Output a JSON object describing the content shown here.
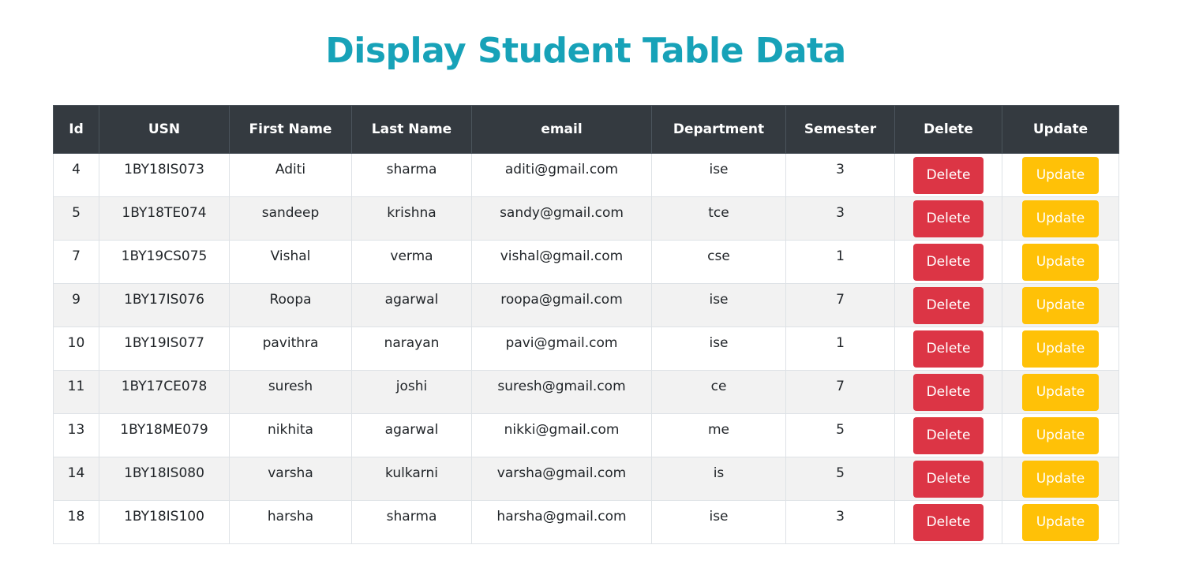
{
  "page": {
    "title": "Display Student Table Data"
  },
  "table": {
    "headers": [
      "Id",
      "USN",
      "First Name",
      "Last Name",
      "email",
      "Department",
      "Semester",
      "Delete",
      "Update"
    ],
    "rows": [
      {
        "id": "4",
        "usn": "1BY18IS073",
        "first_name": "Aditi",
        "last_name": "sharma",
        "email": "aditi@gmail.com",
        "department": "ise",
        "semester": "3",
        "delete_label": "Delete",
        "update_label": "Update"
      },
      {
        "id": "5",
        "usn": "1BY18TE074",
        "first_name": "sandeep",
        "last_name": "krishna",
        "email": "sandy@gmail.com",
        "department": "tce",
        "semester": "3",
        "delete_label": "Delete",
        "update_label": "Update"
      },
      {
        "id": "7",
        "usn": "1BY19CS075",
        "first_name": "Vishal",
        "last_name": "verma",
        "email": "vishal@gmail.com",
        "department": "cse",
        "semester": "1",
        "delete_label": "Delete",
        "update_label": "Update"
      },
      {
        "id": "9",
        "usn": "1BY17IS076",
        "first_name": "Roopa",
        "last_name": "agarwal",
        "email": "roopa@gmail.com",
        "department": "ise",
        "semester": "7",
        "delete_label": "Delete",
        "update_label": "Update"
      },
      {
        "id": "10",
        "usn": "1BY19IS077",
        "first_name": "pavithra",
        "last_name": "narayan",
        "email": "pavi@gmail.com",
        "department": "ise",
        "semester": "1",
        "delete_label": "Delete",
        "update_label": "Update"
      },
      {
        "id": "11",
        "usn": "1BY17CE078",
        "first_name": "suresh",
        "last_name": "joshi",
        "email": "suresh@gmail.com",
        "department": "ce",
        "semester": "7",
        "delete_label": "Delete",
        "update_label": "Update"
      },
      {
        "id": "13",
        "usn": "1BY18ME079",
        "first_name": "nikhita",
        "last_name": "agarwal",
        "email": "nikki@gmail.com",
        "department": "me",
        "semester": "5",
        "delete_label": "Delete",
        "update_label": "Update"
      },
      {
        "id": "14",
        "usn": "1BY18IS080",
        "first_name": "varsha",
        "last_name": "kulkarni",
        "email": "varsha@gmail.com",
        "department": "is",
        "semester": "5",
        "delete_label": "Delete",
        "update_label": "Update"
      },
      {
        "id": "18",
        "usn": "1BY18IS100",
        "first_name": "harsha",
        "last_name": "sharma",
        "email": "harsha@gmail.com",
        "department": "ise",
        "semester": "3",
        "delete_label": "Delete",
        "update_label": "Update"
      }
    ]
  },
  "colors": {
    "title": "#17a2b8",
    "header_bg": "#343a40",
    "delete_button": "#dc3545",
    "update_button": "#ffc107",
    "stripe": "#f2f2f2"
  }
}
